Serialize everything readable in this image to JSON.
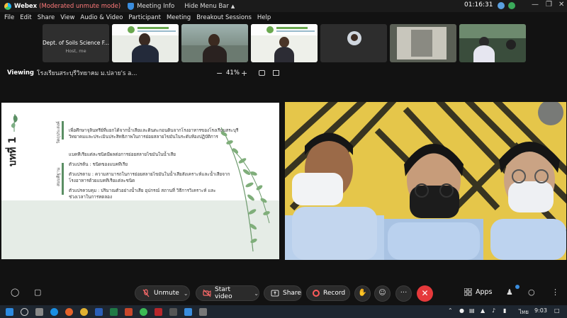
{
  "titlebar": {
    "app_name": "Webex",
    "mode": "(Moderated unmute mode)",
    "meeting_info": "Meeting Info",
    "hide_menu": "Hide Menu Bar",
    "time": "01:16:31",
    "minimize": "—",
    "restore": "❐",
    "close": "✕"
  },
  "menu": [
    "File",
    "Edit",
    "Share",
    "View",
    "Audio & Video",
    "Participant",
    "Meeting",
    "Breakout Sessions",
    "Help"
  ],
  "participants": {
    "host_name": "Dept. of Soils Science F...",
    "host_role": "Host, me"
  },
  "view": {
    "label": "Viewing",
    "title": "โรงเรียนสระบุรีวิทยาคม ม.ปลาย's a...",
    "zoom_minus": "−",
    "zoom": "41%",
    "zoom_plus": "+"
  },
  "slide": {
    "chapter": "บทที่ 1",
    "label_objective": "วัตถุประสงค์",
    "label_hypothesis": "สมมติฐาน",
    "lines": [
      "เพื่อศึกษาจุลินทรีย์ที่แยกได้จากน้ำเสียและดินตะกอนดินจากโรงอาหารของโรงเรียนสระบุรี",
      "วิทยาคมและประเมินประสิทธิภาพในการย่อยสลายไขมันในระดับห้องปฏิบัติการ",
      "แบคทีเรียแต่ละชนิดมีผลต่อการย่อยสลายไขมันในน้ำเสีย",
      "ตัวแปรต้น : ชนิดของแบคทีเรีย",
      "ตัวแปรตาม : ความสามารถในการย่อยสลายไขมันในน้ำเสียสังเคราะห์และน้ำเสียจาก",
      "โรงอาหารด้วยแบคทีเรียแต่ละชนิด",
      "ตัวแปรควบคุม : ปริมาณตัวอย่างน้ำเสีย อุปกรณ์ สถานที่ วิธีการวิเคราะห์ และ",
      "ช่วงเวลาในการทดลอง"
    ]
  },
  "controls": {
    "unmute": "Unmute",
    "start_video": "Start video",
    "share": "Share",
    "record": "Record",
    "more": "···",
    "end": "✕",
    "apps": "Apps"
  },
  "taskbar": {
    "lang": "ไทย",
    "time": "9:03"
  },
  "colors": {
    "accent_green": "#5b8f64",
    "end_red": "#e5393b",
    "record_red": "#ff5b5b"
  }
}
